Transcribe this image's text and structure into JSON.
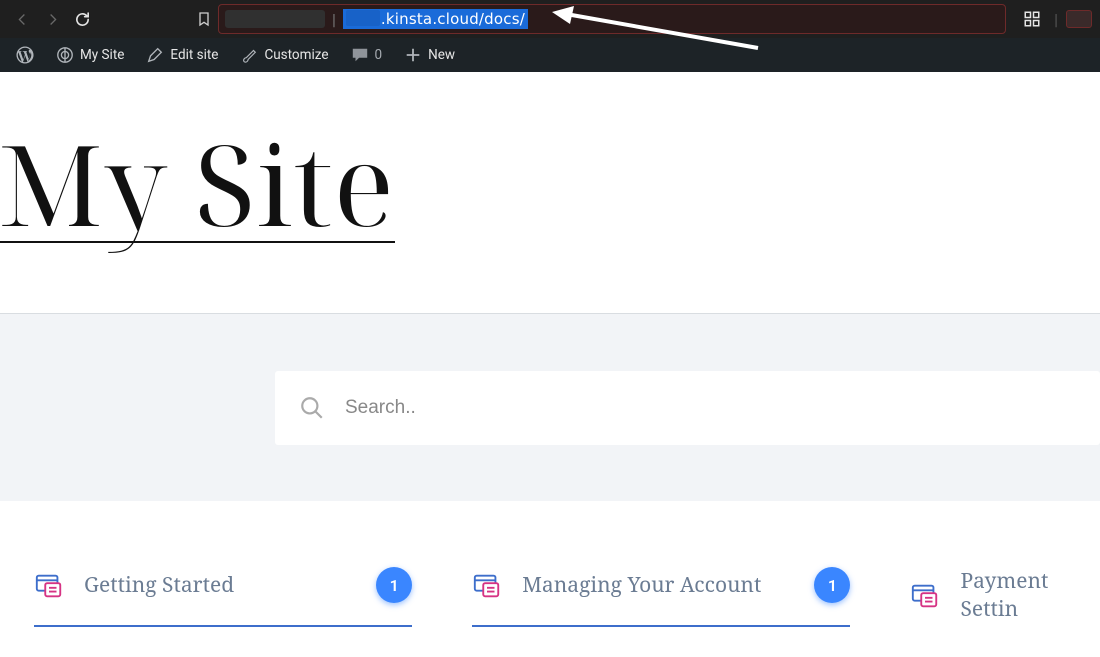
{
  "browser": {
    "url_visible": ".kinsta.cloud/docs/"
  },
  "wp_admin_bar": {
    "my_site": "My Site",
    "edit_site": "Edit site",
    "customize": "Customize",
    "comments_count": "0",
    "new": "New"
  },
  "page": {
    "site_title": "My Site",
    "search_placeholder": "Search..",
    "cards": [
      {
        "title": "Getting Started",
        "count": "1"
      },
      {
        "title": "Managing Your Account",
        "count": "1"
      },
      {
        "title": "Payment Settin"
      }
    ]
  }
}
